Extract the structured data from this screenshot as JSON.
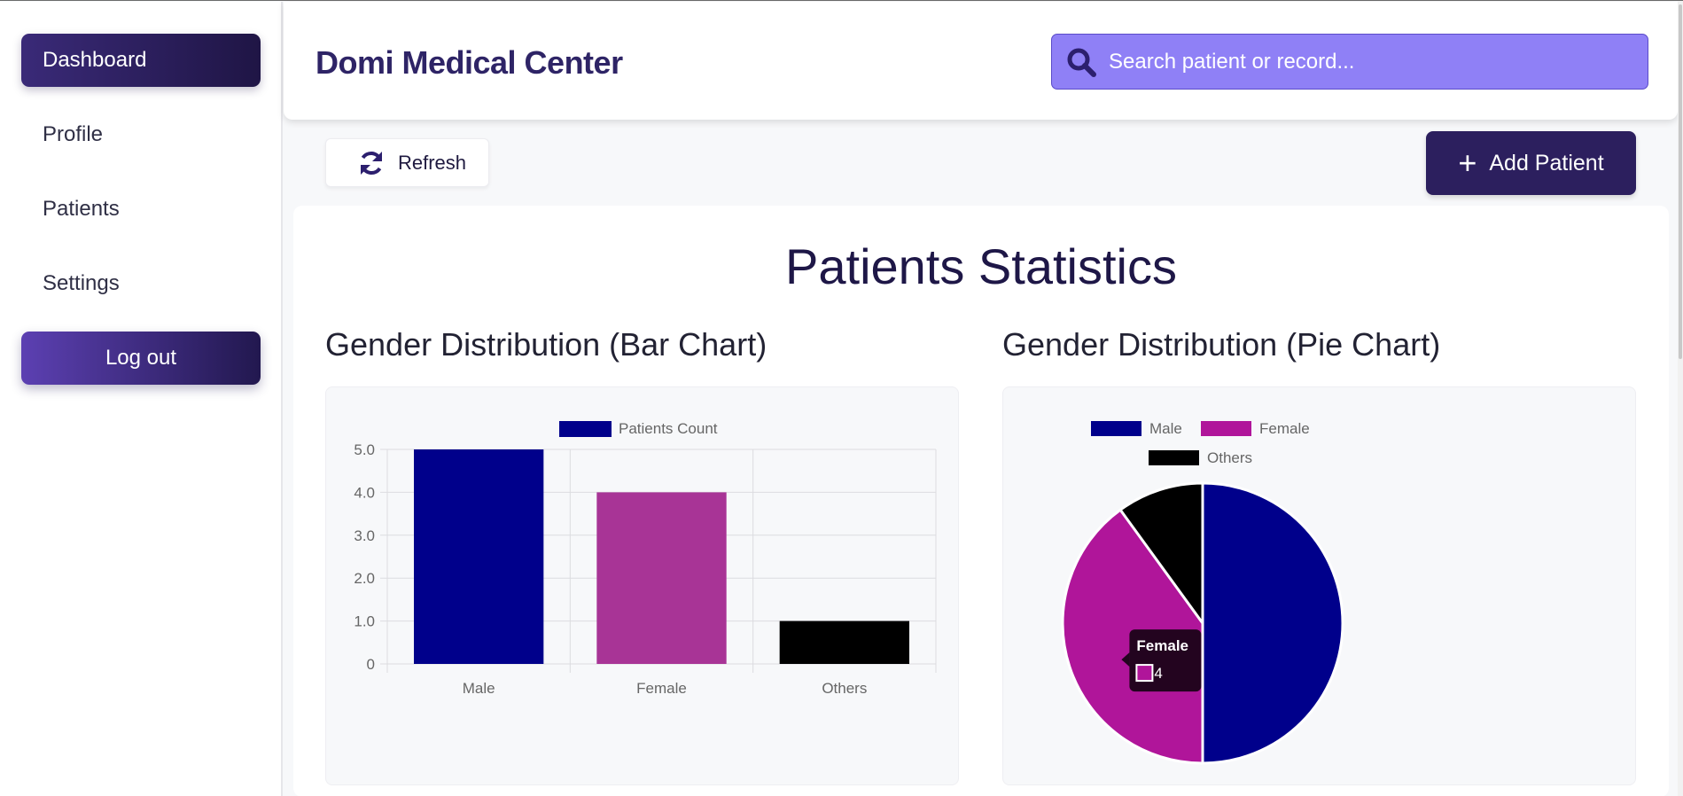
{
  "sidebar": {
    "items": [
      {
        "label": "Dashboard",
        "active": true
      },
      {
        "label": "Profile"
      },
      {
        "label": "Patients"
      },
      {
        "label": "Settings"
      }
    ],
    "logout_label": "Log out"
  },
  "header": {
    "brand": "Domi Medical Center",
    "search_placeholder": "Search patient or record..."
  },
  "toolbar": {
    "refresh_label": "Refresh",
    "add_label": "Add Patient"
  },
  "main": {
    "title": "Patients Statistics",
    "bar_title": "Gender Distribution (Bar Chart)",
    "pie_title": "Gender Distribution (Pie Chart)"
  },
  "colors": {
    "male": "#00008b",
    "female_bar": "#a83496",
    "female_pie": "#b0159a",
    "others": "#000000"
  },
  "chart_data": [
    {
      "type": "bar",
      "categories": [
        "Male",
        "Female",
        "Others"
      ],
      "series": [
        {
          "name": "Patients Count",
          "values": [
            5,
            4,
            1
          ]
        }
      ],
      "ylim": [
        0,
        5
      ],
      "yticks": [
        "0",
        "1.0",
        "2.0",
        "3.0",
        "4.0",
        "5.0"
      ],
      "legend": "top"
    },
    {
      "type": "pie",
      "labels": [
        "Male",
        "Female",
        "Others"
      ],
      "values": [
        5,
        4,
        1
      ],
      "legend": "top",
      "tooltip": {
        "label": "Female",
        "value": "4"
      }
    }
  ]
}
